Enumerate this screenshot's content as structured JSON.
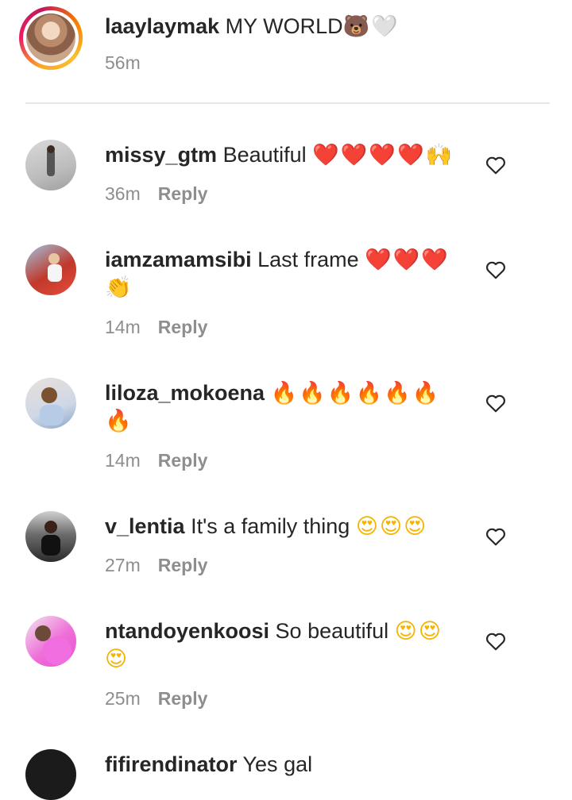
{
  "post": {
    "username": "laaylaymak",
    "caption": "MY WORLD",
    "caption_emoji": "🐻🤍",
    "time": "56m"
  },
  "comments": [
    {
      "username": "missy_gtm",
      "text": "Beautiful",
      "emoji": "❤️❤️❤️❤️🙌",
      "emoji_line2": "",
      "time": "36m",
      "reply": "Reply"
    },
    {
      "username": "iamzamamsibi",
      "text": "Last frame",
      "emoji": "❤️❤️❤️",
      "emoji_line2": "👏",
      "time": "14m",
      "reply": "Reply"
    },
    {
      "username": "liloza_mokoena",
      "text": "",
      "emoji": "🔥🔥🔥🔥🔥🔥",
      "emoji_line2": "🔥",
      "time": "14m",
      "reply": "Reply"
    },
    {
      "username": "v_lentia",
      "text": "It's a family thing",
      "emoji": "😍😍😍",
      "emoji_line2": "",
      "time": "27m",
      "reply": "Reply"
    },
    {
      "username": "ntandoyenkoosi",
      "text": "So beautiful",
      "emoji": "😍😍",
      "emoji_line2": "😍",
      "time": "25m",
      "reply": "Reply"
    },
    {
      "username": "fifirendinator",
      "text": "Yes gal",
      "emoji": "",
      "emoji_line2": "",
      "time": "",
      "reply": ""
    }
  ],
  "icons": {
    "like": "heart-outline-icon"
  },
  "colors": {
    "meta": "#8e8e8e",
    "text": "#262626",
    "divider": "#e6e6e6"
  }
}
